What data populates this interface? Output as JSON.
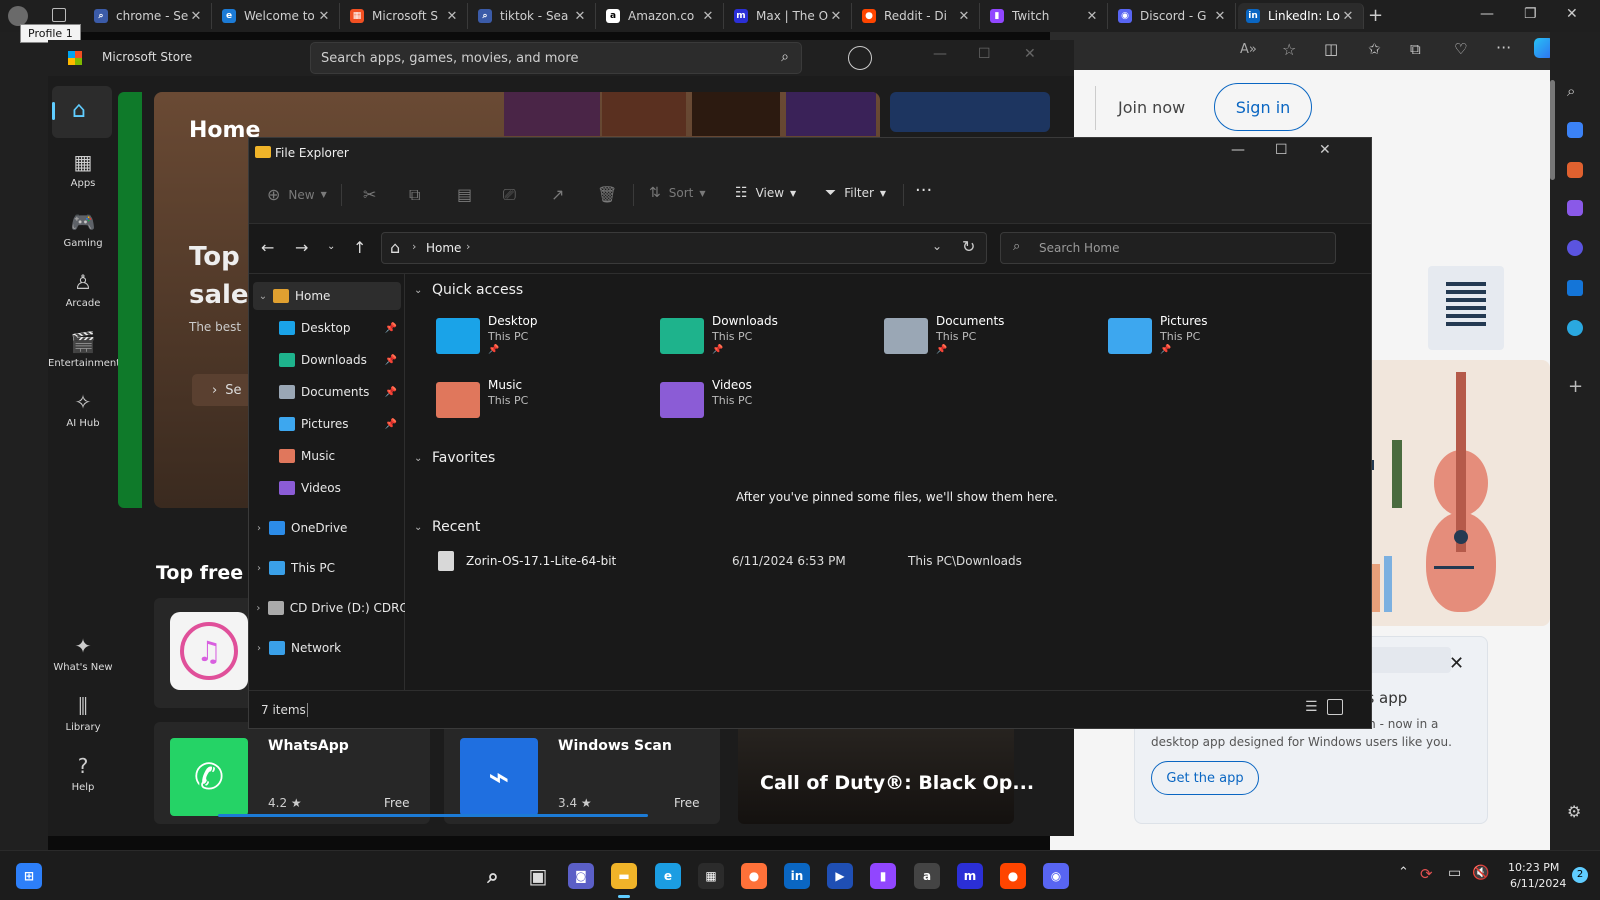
{
  "browser": {
    "tooltip": "Profile 1",
    "tabs": [
      {
        "label": "chrome - Se",
        "color": "#3b5ba8",
        "glyph": "⌕"
      },
      {
        "label": "Welcome to",
        "color": "#1c7bd6",
        "glyph": "e"
      },
      {
        "label": "Microsoft S",
        "color": "#f25022",
        "glyph": "▦"
      },
      {
        "label": "tiktok - Sea",
        "color": "#3b5ba8",
        "glyph": "⌕"
      },
      {
        "label": "Amazon.co",
        "color": "#ffffff",
        "glyph": "a"
      },
      {
        "label": "Max | The O",
        "color": "#2b2fd6",
        "glyph": "m"
      },
      {
        "label": "Reddit - Di",
        "color": "#ff4500",
        "glyph": "●"
      },
      {
        "label": "Twitch",
        "color": "#9146ff",
        "glyph": "▮"
      },
      {
        "label": "Discord - G",
        "color": "#5865f2",
        "glyph": "◉"
      },
      {
        "label": "LinkedIn: Lo",
        "color": "#0a66c2",
        "glyph": "in"
      }
    ],
    "join_now": "Join now",
    "sign_in": "Sign in",
    "partial_text": "mes",
    "popup": {
      "title": "ows app",
      "body_line1": "dIn - now in a",
      "body_line2": "desktop app designed for Windows users like you.",
      "button": "Get the app"
    }
  },
  "store": {
    "window_title": "Microsoft Store",
    "search_placeholder": "Search apps, games, movies, and more",
    "nav": [
      {
        "label": "Apps",
        "icon": "apps-icon"
      },
      {
        "label": "Gaming",
        "icon": "gamepad-icon"
      },
      {
        "label": "Arcade",
        "icon": "arcade-icon"
      },
      {
        "label": "Entertainment",
        "icon": "entertainment-icon"
      },
      {
        "label": "AI Hub",
        "icon": "ai-hub-icon"
      },
      {
        "label": "What's New",
        "icon": "whats-new-icon"
      },
      {
        "label": "Library",
        "icon": "library-icon"
      },
      {
        "label": "Help",
        "icon": "help-icon"
      }
    ],
    "hero_title": "Home",
    "hero_line1": "Top",
    "hero_line2": "sale",
    "hero_line3": "The best",
    "hero_button": "Se",
    "top_free": "Top free a",
    "apps": [
      {
        "name": "WhatsApp",
        "rating": "4.2 ★",
        "price": "Free"
      },
      {
        "name": "Windows Scan",
        "rating": "3.4 ★",
        "price": "Free"
      }
    ],
    "promo": "Call of Duty®: Black Op..."
  },
  "explorer": {
    "title": "File Explorer",
    "commands": {
      "new": "New",
      "sort": "Sort",
      "view": "View",
      "filter": "Filter",
      "more": "···"
    },
    "address": "Home",
    "search_placeholder": "Search Home",
    "nav": {
      "home": "Home",
      "pinned": [
        "Desktop",
        "Downloads",
        "Documents",
        "Pictures"
      ],
      "music": "Music",
      "videos": "Videos",
      "onedrive": "OneDrive",
      "thispc": "This PC",
      "cddrive": "CD Drive (D:) CDROI",
      "network": "Network"
    },
    "sections": {
      "quick_access": "Quick access",
      "favorites": "Favorites",
      "recent": "Recent"
    },
    "quick_access": [
      {
        "name": "Desktop",
        "location": "This PC",
        "color": "#1aa3e8",
        "pinned": true
      },
      {
        "name": "Downloads",
        "location": "This PC",
        "color": "#1eb38c",
        "pinned": true
      },
      {
        "name": "Documents",
        "location": "This PC",
        "color": "#9aa7b5",
        "pinned": true
      },
      {
        "name": "Pictures",
        "location": "This PC",
        "color": "#3da7ef",
        "pinned": true
      },
      {
        "name": "Music",
        "location": "This PC",
        "color": "#e0775c",
        "pinned": false
      },
      {
        "name": "Videos",
        "location": "This PC",
        "color": "#8b5cd6",
        "pinned": false
      }
    ],
    "favorites_empty": "After you've pinned some files, we'll show them here.",
    "recent": [
      {
        "name": "Zorin-OS-17.1-Lite-64-bit",
        "date": "6/11/2024 6:53 PM",
        "location": "This PC\\Downloads"
      }
    ],
    "status": "7 items"
  },
  "taskbar": {
    "time": "10:23 PM",
    "date": "6/11/2024",
    "notifications": "2",
    "apps": [
      {
        "name": "start-button",
        "color": "#2d7ff9",
        "glyph": "⊞"
      },
      {
        "name": "search",
        "color": "transparent",
        "glyph": "⌕"
      },
      {
        "name": "task-view",
        "color": "transparent",
        "glyph": "▣"
      },
      {
        "name": "teams",
        "color": "#5b5fc7",
        "glyph": "◙"
      },
      {
        "name": "file-explorer",
        "color": "#f0b429",
        "glyph": "▬"
      },
      {
        "name": "edge",
        "color": "#1b9de2",
        "glyph": "e"
      },
      {
        "name": "store",
        "color": "#2b2b2b",
        "glyph": "▦"
      },
      {
        "name": "firefox",
        "color": "#ff7139",
        "glyph": "●"
      },
      {
        "name": "linkedin",
        "color": "#0a66c2",
        "glyph": "in"
      },
      {
        "name": "prime-video",
        "color": "#1f4fb4",
        "glyph": "▶"
      },
      {
        "name": "twitch",
        "color": "#9146ff",
        "glyph": "▮"
      },
      {
        "name": "amazon",
        "color": "#444",
        "glyph": "a"
      },
      {
        "name": "max",
        "color": "#2b2fd6",
        "glyph": "m"
      },
      {
        "name": "reddit",
        "color": "#ff4500",
        "glyph": "●"
      },
      {
        "name": "discord",
        "color": "#5865f2",
        "glyph": "◉"
      }
    ]
  }
}
